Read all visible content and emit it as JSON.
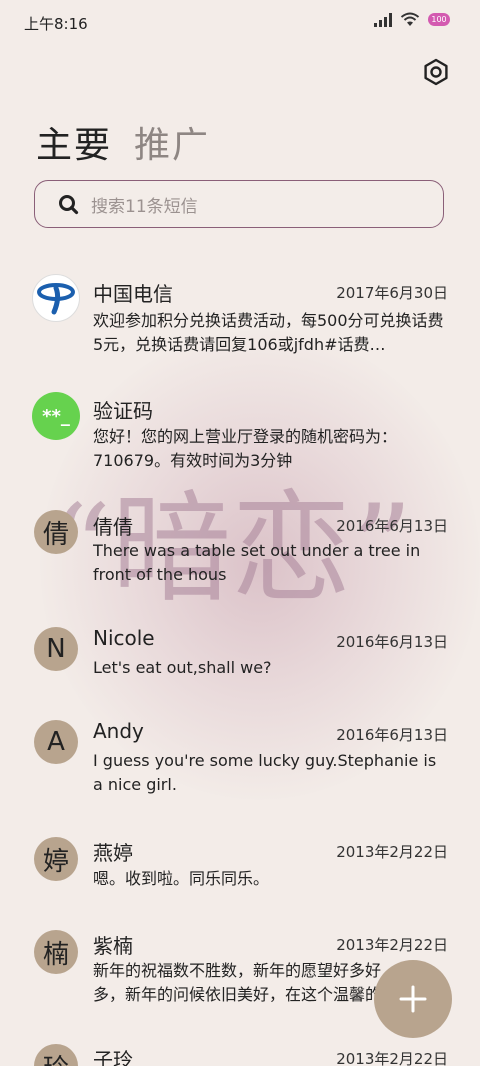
{
  "status_bar": {
    "time": "上午8:16",
    "battery": "100"
  },
  "tabs": {
    "primary": "主要",
    "promo": "推广"
  },
  "search": {
    "placeholder": "搜索11条短信"
  },
  "watermark": {
    "text": "“暗恋”"
  },
  "messages": [
    {
      "avatar": "",
      "avatar_icon": "china-telecom-logo",
      "name": "中国电信",
      "date": "2017年6月30日",
      "text": "欢迎参加积分兑换话费活动，每500分可兑换话费5元，兑换话费请回复106或jfdh#话费…"
    },
    {
      "avatar": "**_",
      "name": "验证码",
      "date": "",
      "text": "您好！您的网上营业厅登录的随机密码为：710679。有效时间为3分钟"
    },
    {
      "avatar": "倩",
      "name": "倩倩",
      "date": "2016年6月13日",
      "text": "There was a table set out under a tree in front of the hous"
    },
    {
      "avatar": "N",
      "name": "Nicole",
      "date": "2016年6月13日",
      "text": "Let's eat out,shall we?"
    },
    {
      "avatar": "A",
      "name": "Andy",
      "date": "2016年6月13日",
      "text": "I guess you're some lucky guy.Stephanie is a nice girl."
    },
    {
      "avatar": "婷",
      "name": "燕婷",
      "date": "2013年2月22日",
      "text": "嗯。收到啦。同乐同乐。"
    },
    {
      "avatar": "楠",
      "name": "紫楠",
      "date": "2013年2月22日",
      "text": "新年的祝福数不胜数，新年的愿望好多好多，新年的问候依旧美好，在这个温馨的"
    },
    {
      "avatar": "玲",
      "name": "子玲",
      "date": "2013年2月22日",
      "text": ""
    }
  ],
  "colors": {
    "accent": "#8a5f78",
    "avatar_bg": "#b8a48e",
    "code_avatar_bg": "#66d24e",
    "background": "#f3ece8"
  }
}
